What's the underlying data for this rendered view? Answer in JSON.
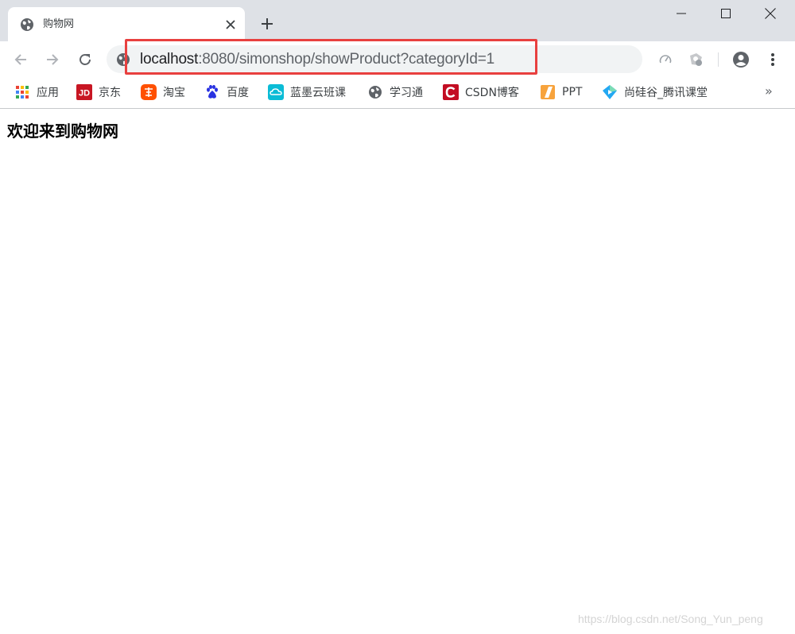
{
  "colors": {
    "titlebar": "#dee1e6",
    "highlight_box": "#e8403f",
    "jd": "#c81623",
    "taobao": "#ff5000",
    "baidu": "#2932e1",
    "lanmo": "#0bbcd6",
    "csdn": "#c30d23",
    "ppt": "#d24726",
    "shanggu": "#23a8f2"
  },
  "tab": {
    "favicon": "globe-icon",
    "title": "购物网",
    "close_icon": "close-icon"
  },
  "new_tab_icon": "plus-icon",
  "window_controls": {
    "minimize": "minimize-icon",
    "maximize": "maximize-icon",
    "close": "close-icon"
  },
  "toolbar": {
    "back_icon": "arrow-left-icon",
    "forward_icon": "arrow-right-icon",
    "reload_icon": "reload-icon",
    "site_info_icon": "globe-icon",
    "url_host": "localhost",
    "url_rest": ":8080/simonshop/showProduct?categoryId=1",
    "right_icons": [
      "speed-icon",
      "extension-icon",
      "profile-icon",
      "menu-icon"
    ]
  },
  "bookmarks": {
    "items": [
      {
        "label": "应用",
        "icon": "apps-grid-icon"
      },
      {
        "label": "京东",
        "icon": "jd-icon"
      },
      {
        "label": "淘宝",
        "icon": "taobao-icon"
      },
      {
        "label": "百度",
        "icon": "baidu-paw-icon"
      },
      {
        "label": "蓝墨云班课",
        "icon": "cloud-icon"
      },
      {
        "label": "学习通",
        "icon": "globe-icon"
      },
      {
        "label": "CSDN博客",
        "icon": "csdn-icon"
      },
      {
        "label": "PPT",
        "icon": "ppt-icon"
      },
      {
        "label": "尚硅谷_腾讯课堂",
        "icon": "diamond-icon"
      }
    ],
    "overflow": "»"
  },
  "page": {
    "heading": "欢迎来到购物网",
    "watermark": "https://blog.csdn.net/Song_Yun_peng"
  }
}
